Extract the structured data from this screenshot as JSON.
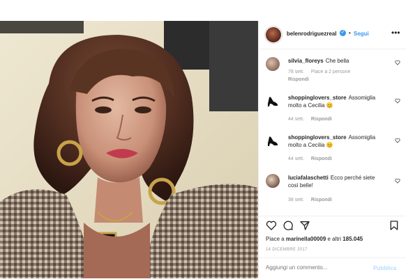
{
  "post": {
    "username": "belenrodriguezreal",
    "follow_label": "Segui",
    "more_label": "•••",
    "verified_mark": "✓"
  },
  "comments": [
    {
      "user": "silvia_floreys",
      "text": "Che bella",
      "time": "78 sett.",
      "likes": "Piace a 2 persone",
      "reply": "Rispondi"
    },
    {
      "user": "shoppinglovers_store",
      "text": "Assomiglia molto a Cecilia 😊",
      "time": "44 sett.",
      "reply": "Rispondi"
    },
    {
      "user": "shoppinglovers_store",
      "text": "Assomiglia molto a Cecilia 😊",
      "time": "44 sett.",
      "reply": "Rispondi"
    },
    {
      "user": "luciafalaschetti",
      "text": "Ecco perché siete così belle!",
      "time": "38 sett.",
      "reply": "Rispondi"
    }
  ],
  "footer": {
    "likes_prefix": "Piace a ",
    "likes_user": "marinella00009",
    "likes_mid": " e altri ",
    "likes_count": "185.045",
    "date": "14 DICEMBRE 2017",
    "comment_placeholder": "Aggiungi un commento...",
    "publish_label": "Pubblica"
  },
  "icons": [
    "heart-icon",
    "comment-icon",
    "share-icon",
    "bookmark-icon",
    "more-icon",
    "verified-icon",
    "shoe-icon"
  ],
  "colors": {
    "link": "#3897f0",
    "muted": "#999999",
    "publish_disabled": "#b3dbff",
    "border": "#efefef"
  }
}
